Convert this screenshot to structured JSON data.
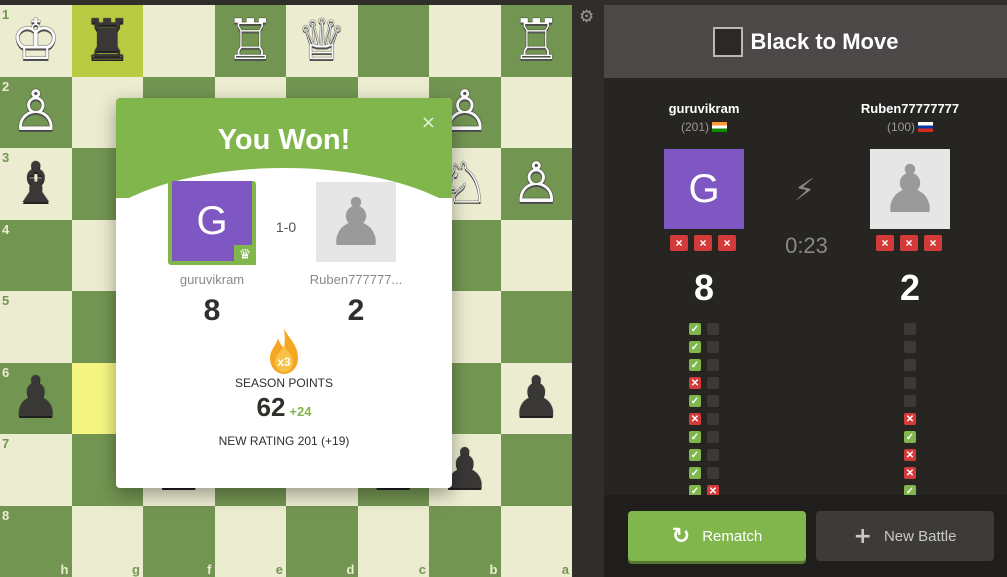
{
  "board": {
    "ranks": [
      "1",
      "2",
      "3",
      "4",
      "5",
      "6",
      "7",
      "8"
    ],
    "files": [
      "h",
      "g",
      "f",
      "e",
      "d",
      "c",
      "b",
      "a"
    ],
    "highlights": [
      {
        "sq": "g1",
        "kind": "from"
      },
      {
        "sq": "g6",
        "kind": "to"
      }
    ],
    "pieces": [
      {
        "sq": "h1",
        "glyph": "♔",
        "color": "w"
      },
      {
        "sq": "g1",
        "glyph": "♜",
        "color": "b"
      },
      {
        "sq": "e1",
        "glyph": "♖",
        "color": "w"
      },
      {
        "sq": "d1",
        "glyph": "♕",
        "color": "w"
      },
      {
        "sq": "a1",
        "glyph": "♖",
        "color": "w"
      },
      {
        "sq": "h2",
        "glyph": "♙",
        "color": "w"
      },
      {
        "sq": "b2",
        "glyph": "♙",
        "color": "w"
      },
      {
        "sq": "h3",
        "glyph": "♝",
        "color": "b"
      },
      {
        "sq": "b3",
        "glyph": "♘",
        "color": "w"
      },
      {
        "sq": "a3",
        "glyph": "♙",
        "color": "w"
      },
      {
        "sq": "h6",
        "glyph": "♟",
        "color": "b"
      },
      {
        "sq": "a6",
        "glyph": "♟",
        "color": "b"
      },
      {
        "sq": "f7",
        "glyph": "♟",
        "color": "b"
      },
      {
        "sq": "c7",
        "glyph": "♟",
        "color": "b"
      },
      {
        "sq": "b7",
        "glyph": "♟",
        "color": "b"
      }
    ]
  },
  "settings_icon": "gear-icon",
  "panel": {
    "to_move": "Black to Move",
    "timer": "0:23",
    "mode_icon": "lightning-bolt-icon",
    "player1": {
      "name": "guruvikram",
      "rating": "(201)",
      "flag": "in",
      "avatar_letter": "G",
      "avatar_color": "#7e57c2",
      "score": "8",
      "strikes": [
        "×",
        "×",
        "×"
      ]
    },
    "player2": {
      "name": "Ruben77777777",
      "rating": "(100)",
      "flag": "ru",
      "avatar_glyph": "♟",
      "score": "2",
      "strikes": [
        "×",
        "×",
        "×"
      ]
    },
    "results_p1": [
      [
        "win",
        "empty"
      ],
      [
        "win",
        "empty"
      ],
      [
        "win",
        "empty"
      ],
      [
        "loss",
        "empty"
      ],
      [
        "win",
        "empty"
      ],
      [
        "loss",
        "empty"
      ],
      [
        "win",
        "empty"
      ],
      [
        "win",
        "empty"
      ],
      [
        "win",
        "empty"
      ],
      [
        "win",
        "loss"
      ]
    ],
    "results_p2": [
      [
        "empty"
      ],
      [
        "empty"
      ],
      [
        "empty"
      ],
      [
        "empty"
      ],
      [
        "empty"
      ],
      [
        "loss"
      ],
      [
        "win"
      ],
      [
        "loss"
      ],
      [
        "loss"
      ],
      [
        "win"
      ]
    ],
    "rematch_label": "Rematch",
    "new_battle_label": "New Battle"
  },
  "modal": {
    "title": "You Won!",
    "close": "×",
    "result": "1-0",
    "p1_name": "guruvikram",
    "p2_name": "Ruben777777...",
    "p1_score": "8",
    "p2_score": "2",
    "multiplier": "x3",
    "season_label": "SEASON POINTS",
    "season_points": "62",
    "season_delta": "+24",
    "new_rating": "NEW RATING 201 (+19)"
  },
  "colors": {
    "accent": "#81b64c",
    "loss": "#d43a3a",
    "board_light": "#ebecd0",
    "board_dark": "#739552"
  }
}
